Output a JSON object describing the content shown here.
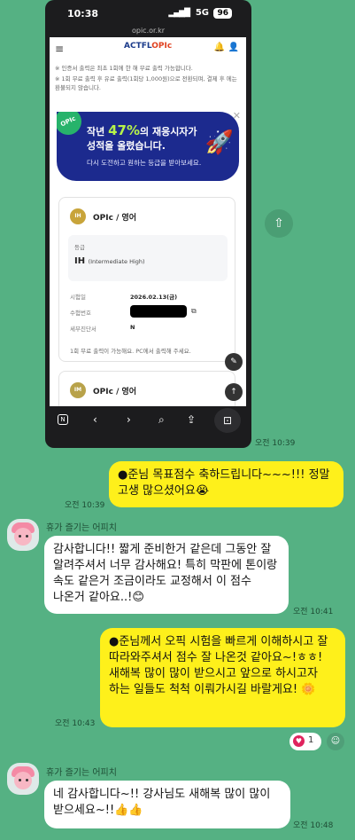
{
  "screenshot": {
    "status": {
      "time": "10:38",
      "network": "5G",
      "battery": "96"
    },
    "url": "opic.or.kr",
    "header": {
      "logo_brand": "ACTFL",
      "logo_product": "OPIc"
    },
    "notices": [
      "※ 인증서 출력은 최초 1회에 한 해 무료 출력 가능합니다.",
      "※ 1회 무료 출력 후 유료 출력(1회당 1,000원)으로 전환되며, 결제 후 에는 환불되지 않습니다."
    ],
    "banner": {
      "badge": "OPIc",
      "line1_pre": "작년",
      "line1_pct": "47%",
      "line1_post": "의 재응시자가",
      "line2": "성적을 올렸습니다.",
      "line3": "다시 도전하고 원하는 등급을 받아보세요."
    },
    "card1": {
      "medal": "IH",
      "title": "OPIc / 영어",
      "grade_label": "등급",
      "grade_value": "IH",
      "grade_desc": "(Intermediate High)",
      "rows": [
        {
          "label": "시험일",
          "value": "2026.02.13(금)"
        },
        {
          "label": "수험번호",
          "value": ""
        },
        {
          "label": "세부진단서",
          "value": "N"
        }
      ],
      "footer": "1회 무료 출력이 가능해요. PC에서 출력해 주세요."
    },
    "card2": {
      "medal": "IM",
      "title": "OPIc / 영어"
    }
  },
  "messages": [
    {
      "type": "time",
      "text": "오전 10:39"
    },
    {
      "type": "yellow",
      "text": "●준님 목표점수 축하드립니다~~~!!! 정말 고생 많으셨어요😭",
      "time": "오전 10:39"
    },
    {
      "sender": "휴가 즐기는 어피치",
      "type": "white",
      "text": "감사합니다!! 짧게 준비한거 같은데 그동안 잘 알려주셔서 너무 감사해요! 특히 막판에 톤이랑 속도 같은거 조금이라도 교정해서 이 점수 나온거 같아요..!😊",
      "time": "오전 10:41"
    },
    {
      "type": "yellow",
      "text": "●준님께서 오픽 시험을 빠르게 이해하시고 잘 따라와주셔서 점수 잘 나온것 같아요~!ㅎㅎ! 새해복 많이 많이 받으시고 앞으로 하시고자 하는 일들도 척척 이뤄가시길 바랄게요! 🌼",
      "time": "오전 10:43",
      "reaction_count": "1"
    },
    {
      "sender": "휴가 즐기는 어피치",
      "type": "white",
      "text": "네 감사합니다~!! 강사님도 새해복 많이 많이 받으세요~!!👍👍",
      "time": "오전 10:48"
    }
  ]
}
